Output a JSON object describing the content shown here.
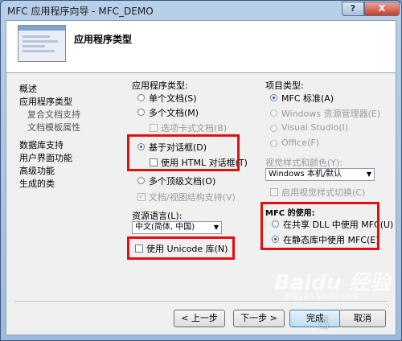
{
  "window": {
    "title": "MFC 应用程序向导 - MFC_DEMO",
    "help_label": "?",
    "close_label": "X"
  },
  "header": {
    "title": "应用程序类型"
  },
  "nav": {
    "items": [
      {
        "label": "概述",
        "sub": false
      },
      {
        "label": "应用程序类型",
        "sub": false
      },
      {
        "label": "复合文档支持",
        "sub": true
      },
      {
        "label": "文档模板属性",
        "sub": true
      },
      {
        "label": "数据库支持",
        "sub": false
      },
      {
        "label": "用户界面功能",
        "sub": false
      },
      {
        "label": "高级功能",
        "sub": false
      },
      {
        "label": "生成的类",
        "sub": false
      }
    ]
  },
  "app_type": {
    "label": "应用程序类型:",
    "single_doc": "单个文档(S)",
    "multi_doc": "多个文档(M)",
    "tabbed_docs": "选项卡式文档(B)",
    "dialog_based": "基于对话框(D)",
    "use_html_dialog": "使用 HTML 对话框(T)",
    "multi_top_level": "多个顶级文档(O)",
    "doc_view_support": "文档/视图结构支持(V)",
    "selected": "dialog_based"
  },
  "resource_language": {
    "label": "资源语言(L):",
    "value": "中文(简体, 中国)"
  },
  "unicode": {
    "label": "使用 Unicode 库(N)",
    "checked": false
  },
  "project_type": {
    "label": "项目类型:",
    "mfc_standard": "MFC 标准(A)",
    "explorer": "Windows 资源管理器(E)",
    "visual_studio": "Visual Studio(I)",
    "office": "Office(F)",
    "selected": "mfc_standard"
  },
  "visual_style": {
    "label": "视觉样式和颜色(Y):",
    "value": "Windows 本机/默认",
    "enable_switch": "启用视觉样式切换(C)"
  },
  "mfc_use": {
    "label": "MFC 的使用:",
    "shared_dll": "在共享 DLL 中使用 MFC(U)",
    "static_lib": "在静态库中使用 MFC(E)",
    "selected": "static_lib"
  },
  "buttons": {
    "back": "< 上一步",
    "next": "下一步 >",
    "finish": "完成",
    "cancel": "取消"
  },
  "watermark": {
    "brand": "Baidu 经验",
    "url": "jingyan.baidu.com"
  },
  "colors": {
    "highlight_box": "#e01010",
    "radio_dot": "#1f4fa0"
  }
}
